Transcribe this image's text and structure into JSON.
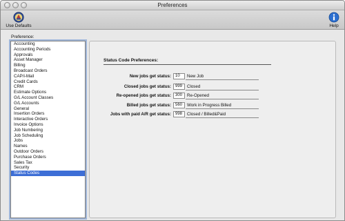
{
  "window": {
    "title": "Preferences"
  },
  "toolbar": {
    "defaults_label": "Use Defaults",
    "help_label": "Help",
    "defaults_icon": "app-badge-icon",
    "help_icon": "info-icon"
  },
  "sidebar": {
    "label": "Preference:",
    "items": [
      "Accounting",
      "Accounting Periods",
      "Approvals",
      "Asset Manager",
      "Billing",
      "Broadcast Orders",
      "CAP/i-Mail",
      "Credit Cards",
      "CRM",
      "Estimate Options",
      "G/L Account Classes",
      "G/L Accounts",
      "General",
      "Insertion Orders",
      "Interactive Orders",
      "Invoice Options",
      "Job Numbering",
      "Job Scheduling",
      "Jobs",
      "Names",
      "Outdoor Orders",
      "Purchase Orders",
      "Sales Tax",
      "Security",
      "Status Codes"
    ],
    "selected_index": 24
  },
  "panel": {
    "title": "Status Code Preferences:",
    "rows": [
      {
        "label": "New jobs get status:",
        "code": "10",
        "description": "New Job"
      },
      {
        "label": "Closed jobs get status:",
        "code": "999",
        "description": "Closed"
      },
      {
        "label": "Re-opened jobs get status:",
        "code": "300",
        "description": "Re-Opened"
      },
      {
        "label": "Billed jobs get status:",
        "code": "560",
        "description": "Work in Progress Billed"
      },
      {
        "label": "Jobs with paid A/R get status:",
        "code": "998",
        "description": "Closed / Billed&Paid"
      }
    ]
  },
  "colors": {
    "selection": "#3d6ed6",
    "focus_ring": "#9fb6d9"
  }
}
